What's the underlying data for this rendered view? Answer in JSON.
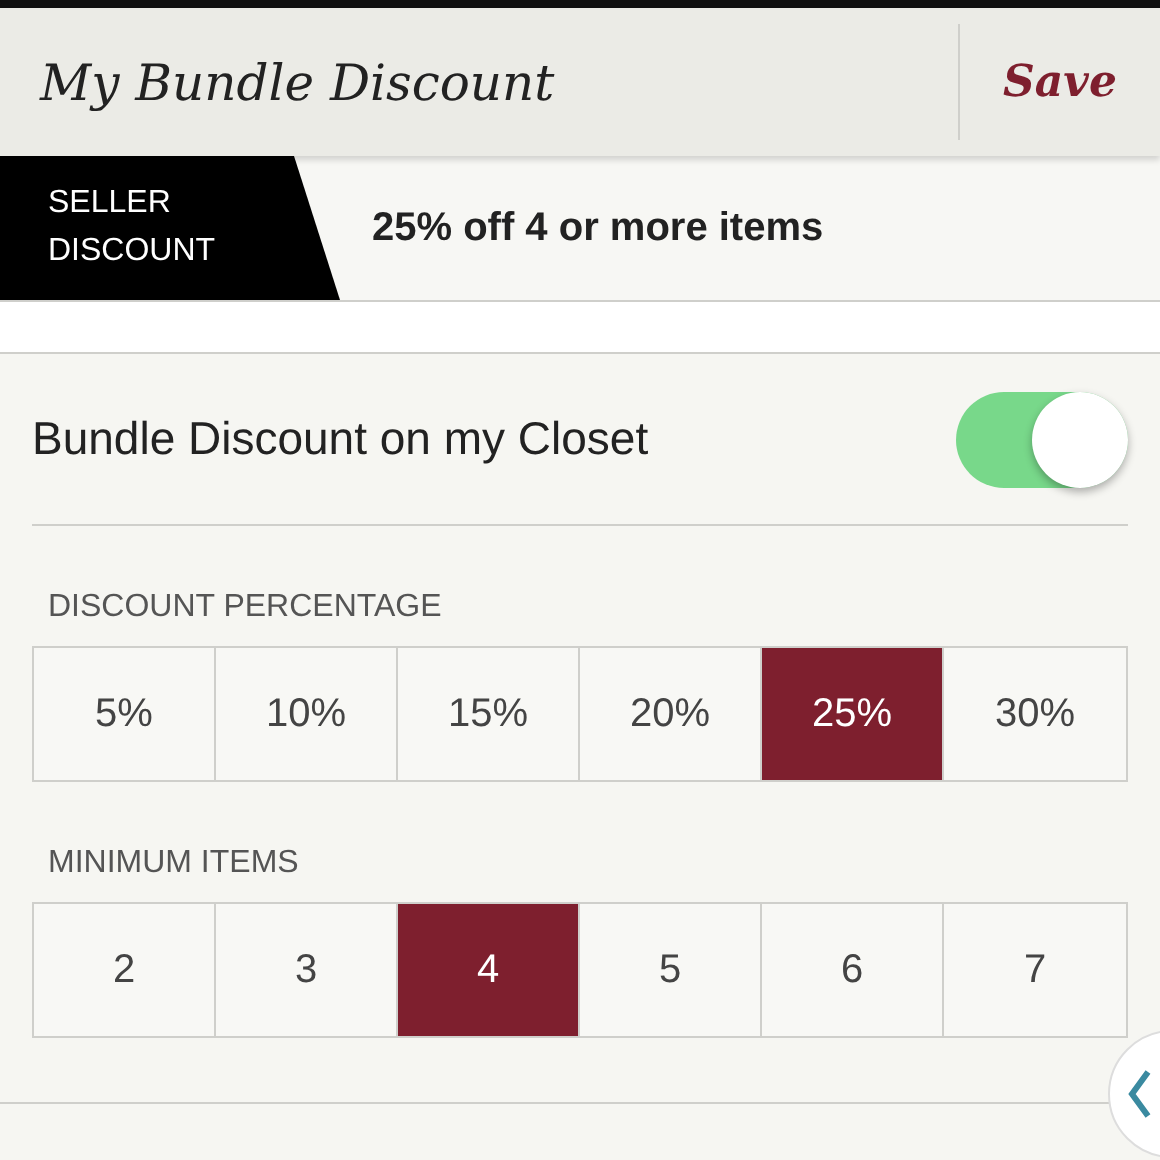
{
  "header": {
    "title": "My Bundle Discount",
    "action": "Save"
  },
  "banner": {
    "badge": "SELLER DISCOUNT",
    "summary": "25% off 4 or more items"
  },
  "toggle": {
    "label": "Bundle Discount on my Closet",
    "on": true
  },
  "groups": [
    {
      "label": "DISCOUNT PERCENTAGE",
      "options": [
        {
          "label": "5%",
          "selected": false
        },
        {
          "label": "10%",
          "selected": false
        },
        {
          "label": "15%",
          "selected": false
        },
        {
          "label": "20%",
          "selected": false
        },
        {
          "label": "25%",
          "selected": true
        },
        {
          "label": "30%",
          "selected": false
        }
      ]
    },
    {
      "label": "MINIMUM ITEMS",
      "options": [
        {
          "label": "2",
          "selected": false
        },
        {
          "label": "3",
          "selected": false
        },
        {
          "label": "4",
          "selected": true
        },
        {
          "label": "5",
          "selected": false
        },
        {
          "label": "6",
          "selected": false
        },
        {
          "label": "7",
          "selected": false
        }
      ]
    }
  ]
}
